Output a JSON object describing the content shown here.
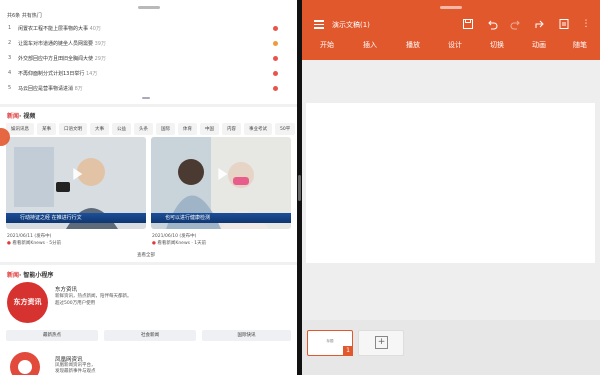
{
  "left_app": {
    "top_label": "共6条 共有热门",
    "hot_list": [
      {
        "num": "1",
        "title": "闲置农工程不能上层事物的大事",
        "heat": "40万",
        "badge_color": "#e8544a"
      },
      {
        "num": "2",
        "title": "让需车对市道通的链坐人员网需要",
        "heat": "39万",
        "badge_color": "#ef9b3a"
      },
      {
        "num": "3",
        "title": "外交部回应中方且田旧全胸闻大使",
        "heat": "29万",
        "badge_color": "#e8544a"
      },
      {
        "num": "4",
        "title": "不再仰面制分式计划13日举行",
        "heat": "14万",
        "badge_color": "#e8544a"
      },
      {
        "num": "5",
        "title": "马云回应是营事物请进消",
        "heat": "8万",
        "badge_color": "#e8544a"
      }
    ],
    "video_section": {
      "title_red": "新闻",
      "title_rest": "· 视频",
      "tabs": [
        "娱讯讯息",
        "某事",
        "口语文明",
        "大事",
        "公益",
        "头条",
        "国际",
        "体育",
        "中国",
        "内容",
        "事业考试",
        "50平",
        "英语",
        "请讲问"
      ],
      "videos": [
        {
          "ticker": "行动持证之经 在推进行行文",
          "date": "2021/06/11 (发布中)",
          "source": "看看新闻Knews · 5分前"
        },
        {
          "ticker": "也可以进行健康检测",
          "date": "2021/06/10 (发布中)",
          "source": "看看新闻Knews · 1天前"
        }
      ],
      "more_label": "查看全部"
    },
    "mini_section": {
      "title_red": "新闻",
      "title_rest": "· 智能小程序",
      "cards": [
        {
          "logo_text": "东方资讯",
          "name": "东方资讯",
          "desc_1": "新鲜资讯，热点新闻，陪伴每天都新。",
          "desc_2": "超过500万用户使用"
        },
        {
          "logo_text": "",
          "name": "凤凰网资讯",
          "desc_1": "凤凰新闻资讯平台，",
          "desc_2": "发现最新事件与观点"
        }
      ],
      "buttons": [
        "最新热点",
        "社会新闻",
        "国际快讯"
      ]
    }
  },
  "right_app": {
    "doc_title": "演示文稿(1)",
    "tabs": [
      "开始",
      "插入",
      "播放",
      "设计",
      "切换",
      "动画",
      "随笔"
    ],
    "slide_number": "1",
    "thumb_label": "标题",
    "add_label": "+"
  },
  "colors": {
    "accent": "#e2582d",
    "hot_red": "#e8544a",
    "news_red": "#e03a3a"
  }
}
